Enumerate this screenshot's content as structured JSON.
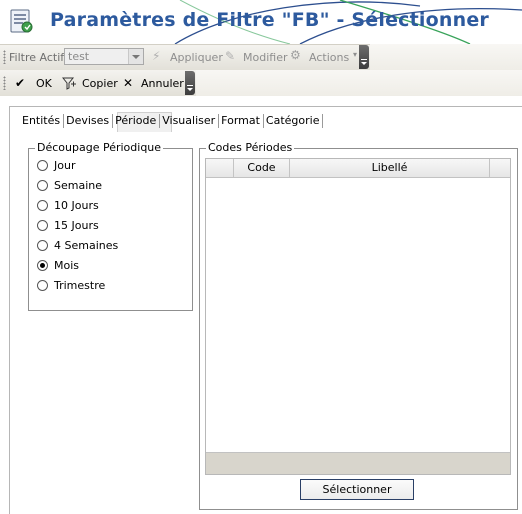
{
  "window": {
    "title": "Paramètres de Filtre \"FB\" - Sélectionner"
  },
  "toolbar_top": {
    "active_filter_label": "Filtre Actif",
    "active_filter_value": "test",
    "apply_label": "Appliquer",
    "modify_label": "Modifier",
    "actions_label": "Actions"
  },
  "toolbar_actions": {
    "ok_label": "OK",
    "copy_label": "Copier",
    "cancel_label": "Annuler"
  },
  "tabs": [
    {
      "label": "Entités",
      "active": false
    },
    {
      "label": "Devises",
      "active": false
    },
    {
      "label": "Période",
      "active": true
    },
    {
      "label": "Visualiser",
      "active": false
    },
    {
      "label": "Format",
      "active": false
    },
    {
      "label": "Catégorie",
      "active": false
    }
  ],
  "periodic_split": {
    "legend": "Découpage Périodique",
    "options": [
      {
        "label": "Jour",
        "checked": false
      },
      {
        "label": "Semaine",
        "checked": false
      },
      {
        "label": "10 Jours",
        "checked": false
      },
      {
        "label": "15 Jours",
        "checked": false
      },
      {
        "label": "4 Semaines",
        "checked": false
      },
      {
        "label": "Mois",
        "checked": true
      },
      {
        "label": "Trimestre",
        "checked": false
      }
    ]
  },
  "period_codes": {
    "legend": "Codes Périodes",
    "columns": [
      "Code",
      "Libellé"
    ],
    "rows": []
  },
  "select_button_label": "Sélectionner",
  "colors": {
    "title": "#2d5a9e",
    "toolbar_end": "#4a4a4a"
  }
}
